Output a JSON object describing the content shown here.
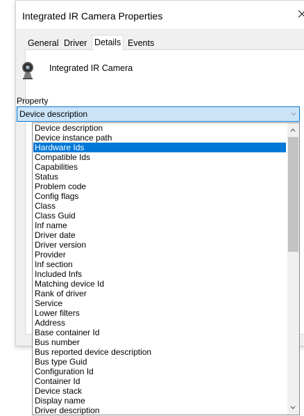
{
  "window": {
    "title": "Integrated IR Camera Properties",
    "close_glyph": "×"
  },
  "tabs": [
    {
      "label": "General",
      "active": false
    },
    {
      "label": "Driver",
      "active": false
    },
    {
      "label": "Details",
      "active": true
    },
    {
      "label": "Events",
      "active": false
    }
  ],
  "device": {
    "icon": "webcam-icon",
    "name": "Integrated IR Camera"
  },
  "property": {
    "label": "Property",
    "selected_value": "Device description"
  },
  "dropdown": {
    "selected_index": 2,
    "items": [
      "Device description",
      "Device instance path",
      "Hardware Ids",
      "Compatible Ids",
      "Capabilities",
      "Status",
      "Problem code",
      "Config flags",
      "Class",
      "Class Guid",
      "Inf name",
      "Driver date",
      "Driver version",
      "Provider",
      "Inf section",
      "Included Infs",
      "Matching device Id",
      "Rank of driver",
      "Service",
      "Lower filters",
      "Address",
      "Base container Id",
      "Bus number",
      "Bus reported device description",
      "Bus type Guid",
      "Configuration Id",
      "Container Id",
      "Device stack",
      "Display name",
      "Driver description"
    ]
  },
  "colors": {
    "selection": "#0078d7",
    "combo_fill": "#cce4f7"
  }
}
